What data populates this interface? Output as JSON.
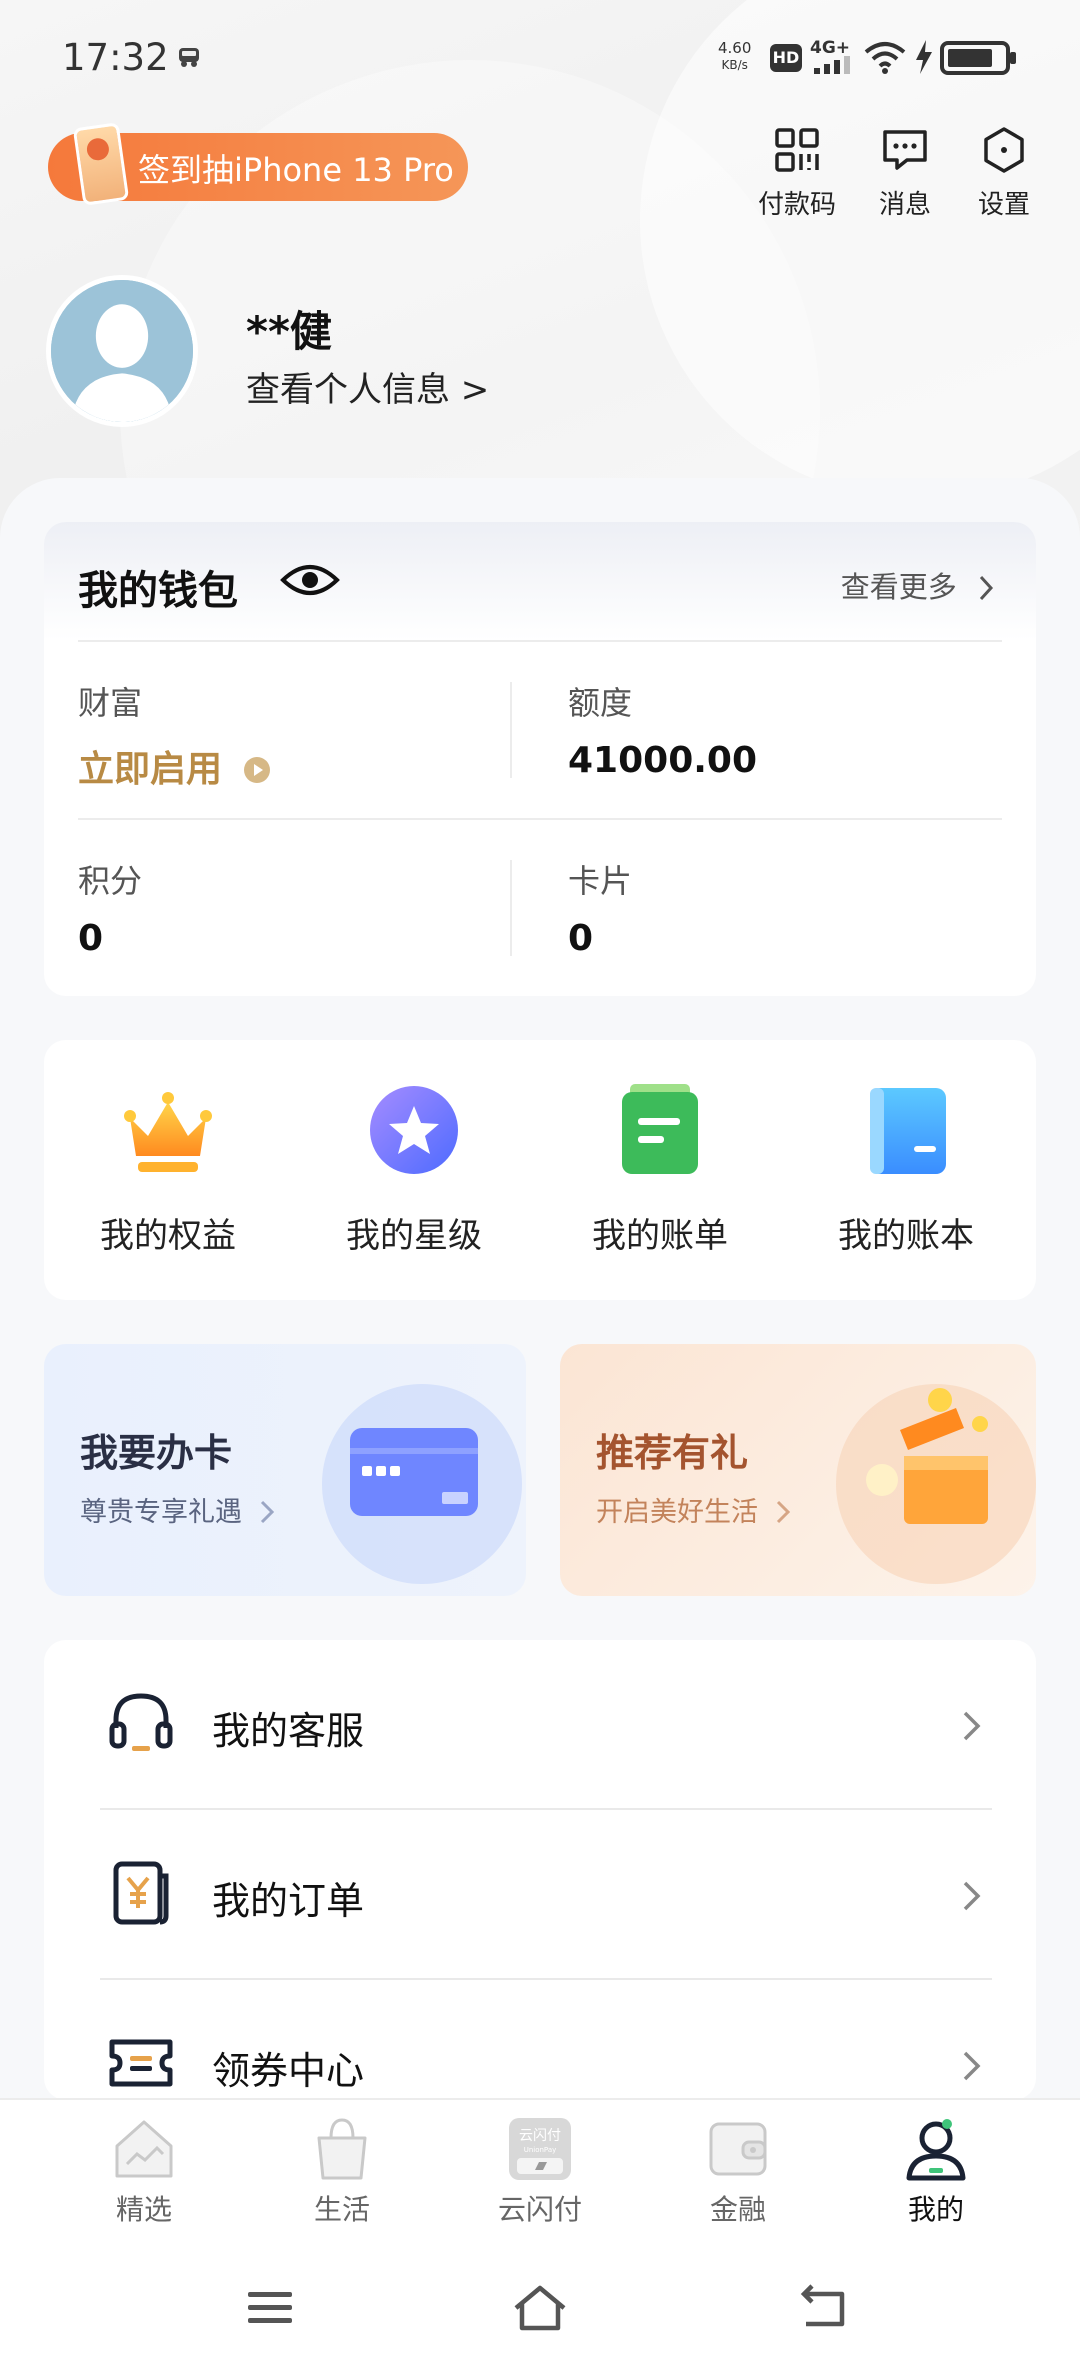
{
  "status_bar": {
    "time": "17:32",
    "net_speed_value": "4.60",
    "net_speed_unit": "KB/s",
    "hd_label": "HD",
    "network_label": "4G+"
  },
  "promo_banner": {
    "label": "签到抽iPhone 13 Pro"
  },
  "top_actions": [
    {
      "label": "付款码",
      "icon": "qr-code-icon"
    },
    {
      "label": "消息",
      "icon": "message-icon"
    },
    {
      "label": "设置",
      "icon": "settings-hexagon-icon"
    }
  ],
  "profile": {
    "name": "**健",
    "info_link": "查看个人信息 >"
  },
  "wallet": {
    "title": "我的钱包",
    "more": "查看更多",
    "cells": [
      {
        "label": "财富",
        "value": "立即启用"
      },
      {
        "label": "额度",
        "value": "41000.00"
      },
      {
        "label": "积分",
        "value": "0"
      },
      {
        "label": "卡片",
        "value": "0"
      }
    ]
  },
  "quick_entries": [
    {
      "label": "我的权益",
      "icon": "crown-icon"
    },
    {
      "label": "我的星级",
      "icon": "star-badge-icon"
    },
    {
      "label": "我的账单",
      "icon": "bill-icon"
    },
    {
      "label": "我的账本",
      "icon": "ledger-book-icon"
    }
  ],
  "promo_cards": [
    {
      "title": "我要办卡",
      "subtitle": "尊贵专享礼遇",
      "icon": "credit-card-icon"
    },
    {
      "title": "推荐有礼",
      "subtitle": "开启美好生活",
      "icon": "gift-box-icon"
    }
  ],
  "list_items": [
    {
      "label": "我的客服",
      "icon": "headset-icon"
    },
    {
      "label": "我的订单",
      "icon": "order-receipt-icon"
    },
    {
      "label": "领券中心",
      "icon": "coupon-icon"
    }
  ],
  "bottom_nav": [
    {
      "label": "精选",
      "icon": "home-icon"
    },
    {
      "label": "生活",
      "icon": "shopping-bag-icon"
    },
    {
      "label": "云闪付",
      "icon": "cloud-pay-icon",
      "logo_text": "云闪付",
      "logo_sub": "UnionPay"
    },
    {
      "label": "金融",
      "icon": "wallet-icon"
    },
    {
      "label": "我的",
      "icon": "user-icon",
      "active": true
    }
  ],
  "colors": {
    "promo_orange": "#f5793b",
    "wealth_gold": "#b88a44",
    "recommend_brown": "#a4542f",
    "card_blue_text": "#2a2f45",
    "active_nav": "#1a2233",
    "accent_green": "#3fc47a"
  }
}
